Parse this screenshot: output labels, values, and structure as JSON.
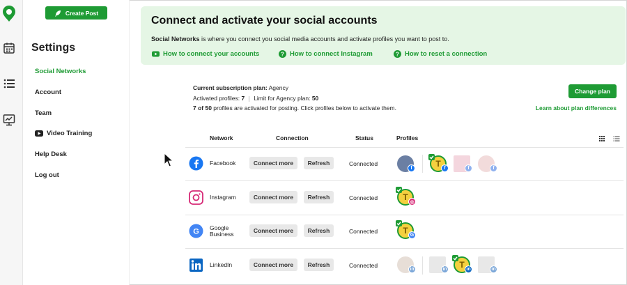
{
  "sidebar": {
    "create_post": "Create Post",
    "title": "Settings",
    "items": [
      {
        "label": "Social Networks"
      },
      {
        "label": "Account"
      },
      {
        "label": "Team"
      },
      {
        "label": "Video Training"
      },
      {
        "label": "Help Desk"
      },
      {
        "label": "Log out"
      }
    ]
  },
  "banner": {
    "title": "Connect and activate your social accounts",
    "desc_bold": "Social Networks",
    "desc_rest": " is where you connect you social media accounts and activate profiles you want to post to.",
    "links": [
      {
        "label": "How to connect your accounts",
        "icon": "youtube-icon"
      },
      {
        "label": "How to connect Instagram",
        "icon": "help-icon"
      },
      {
        "label": "How to reset a connection",
        "icon": "help-icon"
      }
    ]
  },
  "plan": {
    "plan_label": "Current subscription plan:",
    "plan_value": " Agency",
    "activated_label": "Activated profiles: ",
    "activated_value": "7",
    "limit_label": "Limit for Agency plan: ",
    "limit_value": "50",
    "summary_bold": "7 of 50",
    "summary_rest": " profiles are activated for posting. Click profiles below to activate them.",
    "change_plan": "Change plan",
    "learn_link": "Learn about plan differences"
  },
  "table": {
    "headers": {
      "network": "Network",
      "connection": "Connection",
      "status": "Status",
      "profiles": "Profiles"
    },
    "connect_more": "Connect more",
    "refresh": "Refresh",
    "rows": [
      {
        "network": "Facebook",
        "status": "Connected",
        "color": "#1877f2"
      },
      {
        "network": "Instagram",
        "status": "Connected",
        "color": "#d62976"
      },
      {
        "network": "Google Business",
        "network_line1": "Google",
        "network_line2": "Business",
        "status": "Connected",
        "color": "#4285f4"
      },
      {
        "network": "LinkedIn",
        "status": "Connected",
        "color": "#0a66c2"
      }
    ],
    "avatar_letter": "T"
  },
  "colors": {
    "brand": "#1e9b34",
    "banner_bg": "#e5f6e5"
  }
}
